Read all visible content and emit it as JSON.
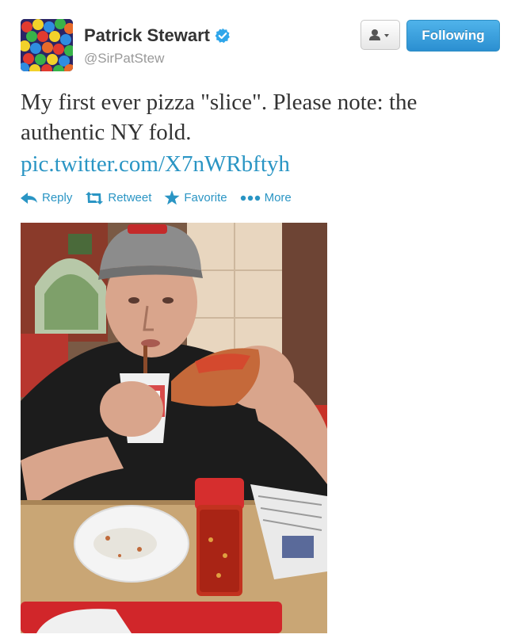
{
  "user": {
    "name": "Patrick Stewart",
    "handle": "@SirPatStew",
    "verified": true
  },
  "header": {
    "follow_label": "Following",
    "user_menu_icon": "person-dropdown-icon"
  },
  "tweet": {
    "text": "My first ever pizza \"slice\". Please note: the authentic NY fold.",
    "link": "pic.twitter.com/X7nWRbftyh"
  },
  "actions": [
    {
      "label": "Reply",
      "icon": "reply-icon"
    },
    {
      "label": "Retweet",
      "icon": "retweet-icon"
    },
    {
      "label": "Favorite",
      "icon": "star-icon"
    },
    {
      "label": "More",
      "icon": "dots-icon"
    }
  ],
  "colors": {
    "link": "#2a95c4",
    "follow_button": "#2b8fd1",
    "name": "#333333",
    "handle": "#999999"
  }
}
